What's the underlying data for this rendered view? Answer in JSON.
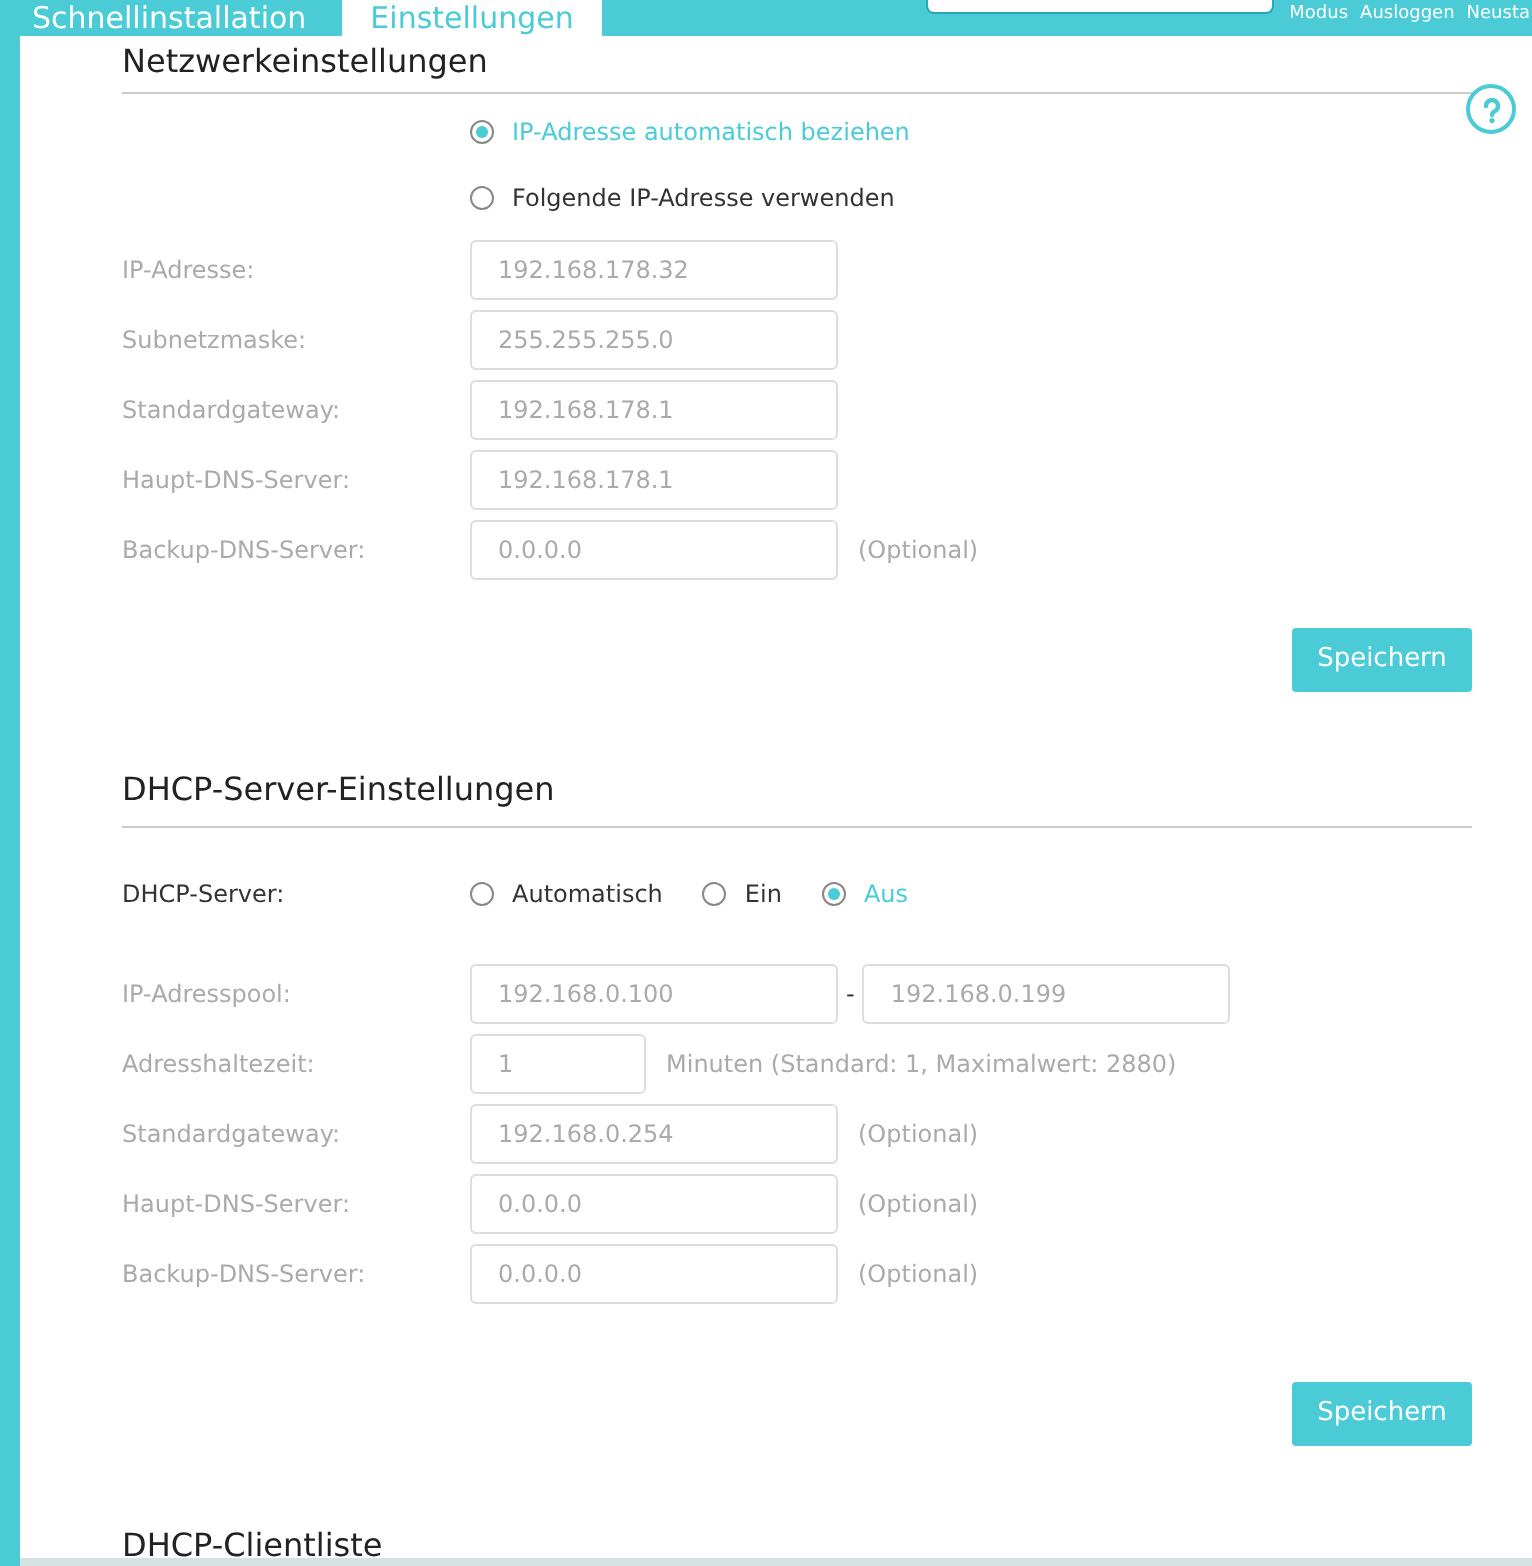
{
  "header": {
    "tabs": [
      {
        "label": "Schnellinstallation",
        "selected": false
      },
      {
        "label": "Einstellungen",
        "selected": true
      }
    ],
    "links": [
      "Modus",
      "Ausloggen",
      "Neusta"
    ]
  },
  "network": {
    "title": "Netzwerkeinstellungen",
    "options": [
      {
        "label": "IP-Adresse automatisch beziehen",
        "selected": true
      },
      {
        "label": "Folgende IP-Adresse verwenden",
        "selected": false
      }
    ],
    "fields": [
      {
        "label": "IP-Adresse:",
        "value": "192.168.178.32",
        "disabled": true
      },
      {
        "label": "Subnetzmaske:",
        "value": "255.255.255.0",
        "disabled": true
      },
      {
        "label": "Standardgateway:",
        "value": "192.168.178.1",
        "disabled": true
      },
      {
        "label": "Haupt-DNS-Server:",
        "value": "192.168.178.1",
        "disabled": true
      },
      {
        "label": "Backup-DNS-Server:",
        "value": "0.0.0.0",
        "note": "(Optional)",
        "disabled": true
      }
    ],
    "save": "Speichern"
  },
  "dhcp": {
    "title": "DHCP-Server-Einstellungen",
    "server_label": "DHCP-Server:",
    "options": [
      {
        "label": "Automatisch",
        "selected": false
      },
      {
        "label": "Ein",
        "selected": false
      },
      {
        "label": "Aus",
        "selected": true
      }
    ],
    "fields": [
      {
        "kind": "range",
        "label": "IP-Adresspool:",
        "value": "192.168.0.100",
        "separator": "-",
        "value_2": "192.168.0.199",
        "disabled": true
      },
      {
        "kind": "short",
        "label": "Adresshaltezeit:",
        "value": "1",
        "note": "Minuten (Standard: 1, Maximalwert: 2880)",
        "disabled": true
      },
      {
        "kind": "text",
        "label": "Standardgateway:",
        "value": "192.168.0.254",
        "note": "(Optional)",
        "disabled": true
      },
      {
        "kind": "text",
        "label": "Haupt-DNS-Server:",
        "value": "0.0.0.0",
        "note": "(Optional)",
        "disabled": true
      },
      {
        "kind": "text",
        "label": "Backup-DNS-Server:",
        "value": "0.0.0.0",
        "note": "(Optional)",
        "disabled": true
      }
    ],
    "save": "Speichern"
  },
  "client_list": {
    "title": "DHCP-Clientliste"
  }
}
